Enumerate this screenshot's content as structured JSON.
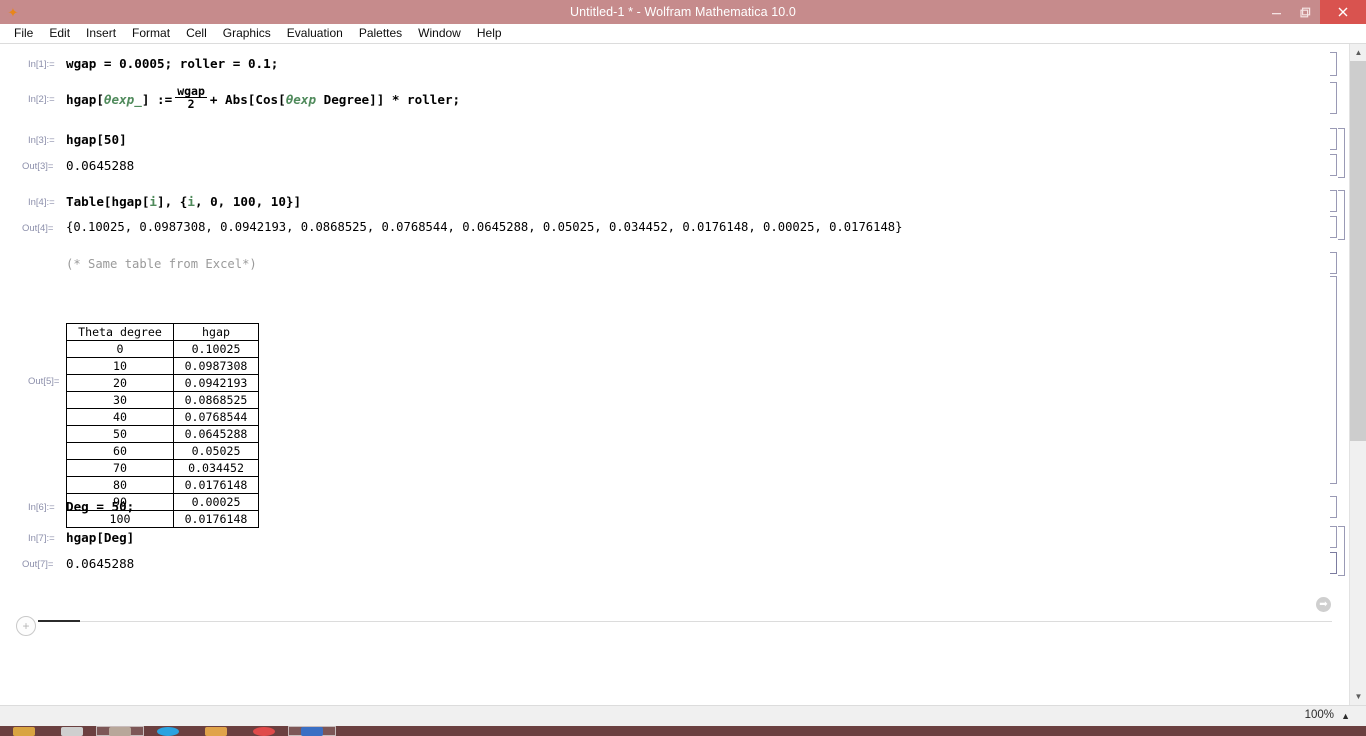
{
  "window": {
    "title": "Untitled-1 * - Wolfram Mathematica 10.0",
    "app_icon": "mathematica-spikey-icon",
    "minimize_label": "–",
    "maximize_label": "❐",
    "close_label": "✕",
    "titlebar_color": "#c68b8c",
    "close_color": "#d9534f"
  },
  "menubar": {
    "items": [
      {
        "label": "File"
      },
      {
        "label": "Edit"
      },
      {
        "label": "Insert"
      },
      {
        "label": "Format"
      },
      {
        "label": "Cell"
      },
      {
        "label": "Graphics"
      },
      {
        "label": "Evaluation"
      },
      {
        "label": "Palettes"
      },
      {
        "label": "Window"
      },
      {
        "label": "Help"
      }
    ]
  },
  "notebook": {
    "cells": {
      "in1": {
        "label": "In[1]:=",
        "code": "wgap = 0.0005; roller = 0.1;"
      },
      "in2": {
        "label": "In[2]:=",
        "prefix": "hgap[",
        "pattern": "θexp_",
        "assign": "] :=",
        "frac_num": "wgap",
        "frac_den": "2",
        "plus": "+ Abs[Cos[",
        "pattern2": "θexp",
        "degree": " Degree]] * roller;"
      },
      "in3": {
        "label": "In[3]:=",
        "code": "hgap[50]"
      },
      "out3": {
        "label": "Out[3]=",
        "value": "0.0645288"
      },
      "in4": {
        "label": "In[4]:=",
        "code_a": "Table[hgap[",
        "code_i": "i",
        "code_b": "], {",
        "code_i2": "i",
        "code_c": ", 0, 100, 10}]"
      },
      "out4": {
        "label": "Out[4]=",
        "value": "{0.10025, 0.0987308, 0.0942193, 0.0868525, 0.0768544, 0.0645288, 0.05025, 0.034452, 0.0176148, 0.00025, 0.0176148}"
      },
      "comment": {
        "text": "(* Same table from Excel*)"
      },
      "out5": {
        "label": "Out[5]="
      },
      "in6": {
        "label": "In[6]:=",
        "code": "Deg = 50;"
      },
      "in7": {
        "label": "In[7]:=",
        "code": "hgap[Deg]"
      },
      "out7": {
        "label": "Out[7]=",
        "value": "0.0645288"
      }
    },
    "table": {
      "headers": [
        "Theta degree",
        "hgap"
      ],
      "rows": [
        [
          "0",
          "0.10025"
        ],
        [
          "10",
          "0.0987308"
        ],
        [
          "20",
          "0.0942193"
        ],
        [
          "30",
          "0.0868525"
        ],
        [
          "40",
          "0.0768544"
        ],
        [
          "50",
          "0.0645288"
        ],
        [
          "60",
          "0.05025"
        ],
        [
          "70",
          "0.034452"
        ],
        [
          "80",
          "0.0176148"
        ],
        [
          "90",
          "0.00025"
        ],
        [
          "100",
          "0.0176148"
        ]
      ]
    },
    "insertion": {
      "plus_label": "+",
      "suggestions_icon": "➡"
    }
  },
  "scrollbar": {
    "up_arrow": "▲",
    "down_arrow": "▼"
  },
  "statusbar": {
    "zoom": "100%",
    "zoom_caret": "▲"
  },
  "taskbar": {
    "items": [
      {
        "name": "taskbar-item-explorer",
        "color": "#d9a441",
        "active": false
      },
      {
        "name": "taskbar-item-calculator",
        "color": "#cfcfcf",
        "active": false
      },
      {
        "name": "taskbar-item-mathematica",
        "color": "#b8a79a",
        "active": true
      },
      {
        "name": "taskbar-item-browser",
        "color": "#2aa3e0",
        "active": false
      },
      {
        "name": "taskbar-item-folder",
        "color": "#e0a34a",
        "active": false
      },
      {
        "name": "taskbar-item-media",
        "color": "#e04a4a",
        "active": false
      },
      {
        "name": "taskbar-item-editor",
        "color": "#3a6fc4",
        "active": true
      }
    ]
  }
}
